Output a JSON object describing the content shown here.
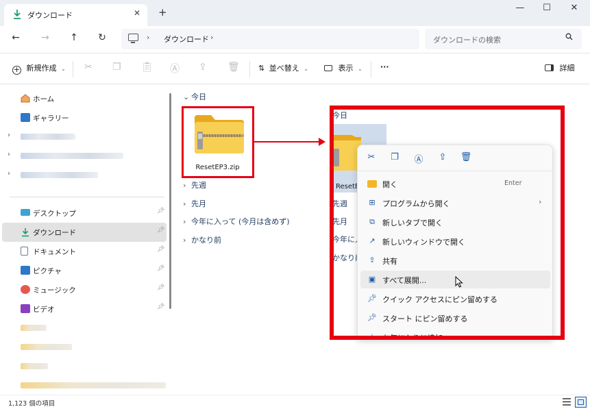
{
  "window": {
    "tab_title": "ダウンロード",
    "close_tab": "✕",
    "new_tab": "+",
    "minimize": "—",
    "maximize": "☐",
    "close": "✕"
  },
  "address": {
    "crumb": "ダウンロード",
    "sep": "›",
    "search_placeholder": "ダウンロードの検索"
  },
  "toolbar": {
    "new_label": "新規作成",
    "sort_label": "並べ替え",
    "view_label": "表示",
    "more": "···",
    "details_label": "詳細"
  },
  "sidebar": {
    "home": "ホーム",
    "gallery": "ギャラリー",
    "desktop": "デスクトップ",
    "downloads": "ダウンロード",
    "documents": "ドキュメント",
    "pictures": "ピクチャ",
    "music": "ミュージック",
    "videos": "ビデオ"
  },
  "content": {
    "groups": [
      "今日",
      "先週",
      "先月",
      "今年に入って (今月は含めず)",
      "かなり前"
    ],
    "file_name": "ResetEP3.zip",
    "under_groups": [
      "今日",
      "先週",
      "先月",
      "今年に入",
      "かなり前"
    ],
    "under_file_name": "ResetE"
  },
  "context_menu": {
    "items": [
      {
        "label": "開く",
        "accel": "Enter"
      },
      {
        "label": "プログラムから開く",
        "sub": "›"
      },
      {
        "label": "新しいタブで開く"
      },
      {
        "label": "新しいウィンドウで開く"
      },
      {
        "label": "共有"
      },
      {
        "label": "すべて展開..."
      },
      {
        "label": "クイック アクセスにピン留めする"
      },
      {
        "label": "スタート にピン留めする"
      },
      {
        "label": "お気に入りに追加"
      }
    ]
  },
  "status": {
    "count": "1,123 個の項目"
  },
  "colors": {
    "accent": "#1d5ca8",
    "highlight_red": "#e60012",
    "folder_yellow": "#f5c43c"
  }
}
